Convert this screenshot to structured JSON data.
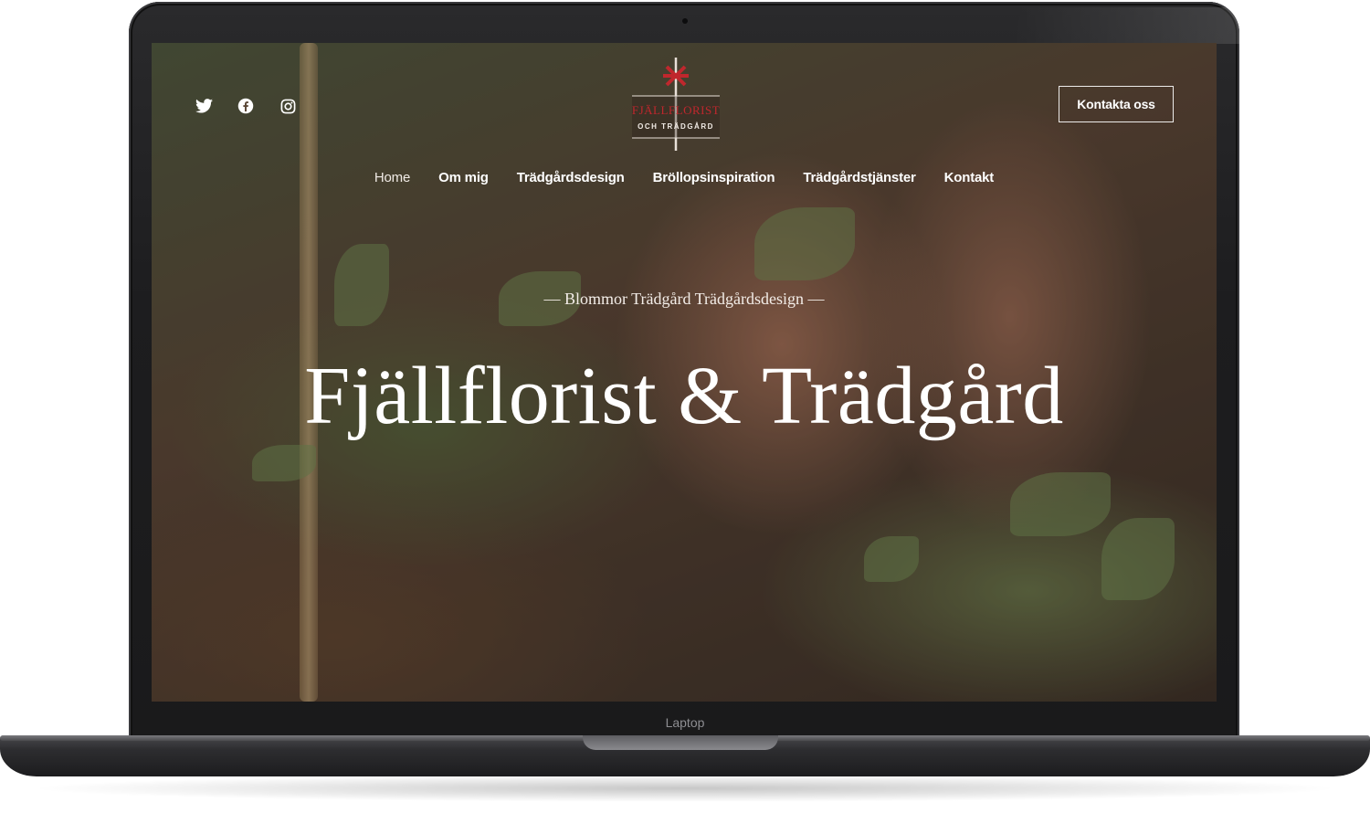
{
  "device": {
    "label": "Laptop"
  },
  "site": {
    "logo": {
      "name_line1": "FJÄLLFLORIST",
      "name_line2": "OCH TRÄDGÅRD",
      "accent_color": "#c0272d"
    },
    "socials": [
      {
        "icon": "twitter-icon"
      },
      {
        "icon": "facebook-icon"
      },
      {
        "icon": "instagram-icon"
      }
    ],
    "cta_label": "Kontakta oss",
    "nav": [
      {
        "label": "Home",
        "active": true
      },
      {
        "label": "Om mig"
      },
      {
        "label": "Trädgårdsdesign"
      },
      {
        "label": "Bröllopsinspiration"
      },
      {
        "label": "Trädgårdstjänster"
      },
      {
        "label": "Kontakt"
      }
    ],
    "hero": {
      "tagline": "— Blommor Trädgård Trädgårdsdesign —",
      "title": "Fjällflorist & Trädgård"
    }
  }
}
